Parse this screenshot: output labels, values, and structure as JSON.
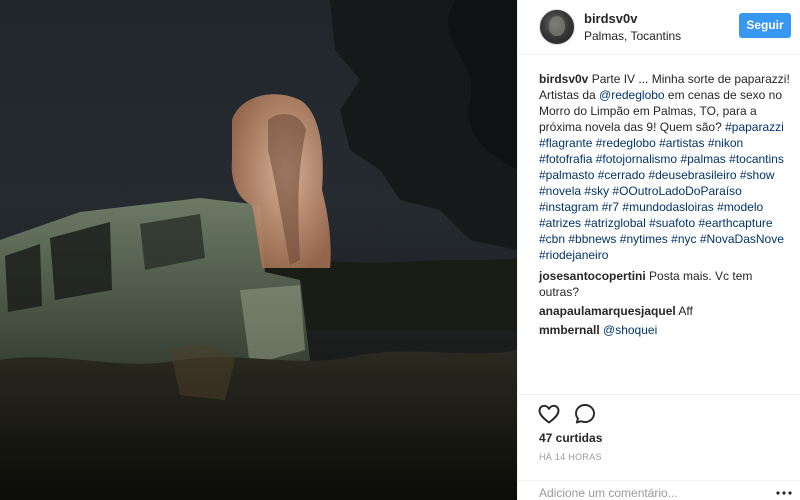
{
  "post": {
    "username": "birdsv0v",
    "location": "Palmas, Tocantins",
    "follow_label": "Seguir",
    "caption": {
      "user": "birdsv0v",
      "parts": [
        {
          "t": "text",
          "v": " Parte IV ... Minha sorte de paparazzi! Artistas da "
        },
        {
          "t": "mention",
          "v": "@redeglobo"
        },
        {
          "t": "text",
          "v": " em cenas de sexo no Morro do Limpão em Palmas, TO, para a próxima novela das 9! Quem são? "
        },
        {
          "t": "tag",
          "v": "#paparazzi"
        },
        {
          "t": "text",
          "v": " "
        },
        {
          "t": "tag",
          "v": "#flagrante"
        },
        {
          "t": "text",
          "v": " "
        },
        {
          "t": "tag",
          "v": "#redeglobo"
        },
        {
          "t": "text",
          "v": " "
        },
        {
          "t": "tag",
          "v": "#artistas"
        },
        {
          "t": "text",
          "v": " "
        },
        {
          "t": "tag",
          "v": "#nikon"
        },
        {
          "t": "text",
          "v": " "
        },
        {
          "t": "tag",
          "v": "#fotofrafia"
        },
        {
          "t": "text",
          "v": " "
        },
        {
          "t": "tag",
          "v": "#fotojornalismo"
        },
        {
          "t": "text",
          "v": " "
        },
        {
          "t": "tag",
          "v": "#palmas"
        },
        {
          "t": "text",
          "v": " "
        },
        {
          "t": "tag",
          "v": "#tocantins"
        },
        {
          "t": "text",
          "v": " "
        },
        {
          "t": "tag",
          "v": "#palmasto"
        },
        {
          "t": "text",
          "v": " "
        },
        {
          "t": "tag",
          "v": "#cerrado"
        },
        {
          "t": "text",
          "v": " "
        },
        {
          "t": "tag",
          "v": "#deusebrasileiro"
        },
        {
          "t": "text",
          "v": " "
        },
        {
          "t": "tag",
          "v": "#show"
        },
        {
          "t": "text",
          "v": " "
        },
        {
          "t": "tag",
          "v": "#novela"
        },
        {
          "t": "text",
          "v": " "
        },
        {
          "t": "tag",
          "v": "#sky"
        },
        {
          "t": "text",
          "v": " "
        },
        {
          "t": "tag",
          "v": "#OOutroLadoDoParaíso"
        },
        {
          "t": "text",
          "v": " "
        },
        {
          "t": "tag",
          "v": "#instagram"
        },
        {
          "t": "text",
          "v": " "
        },
        {
          "t": "tag",
          "v": "#r7"
        },
        {
          "t": "text",
          "v": " "
        },
        {
          "t": "tag",
          "v": "#mundodasloiras"
        },
        {
          "t": "text",
          "v": " "
        },
        {
          "t": "tag",
          "v": "#modelo"
        },
        {
          "t": "text",
          "v": " "
        },
        {
          "t": "tag",
          "v": "#atrizes"
        },
        {
          "t": "text",
          "v": " "
        },
        {
          "t": "tag",
          "v": "#atrizglobal"
        },
        {
          "t": "text",
          "v": " "
        },
        {
          "t": "tag",
          "v": "#suafoto"
        },
        {
          "t": "text",
          "v": " "
        },
        {
          "t": "tag",
          "v": "#earthcapture"
        },
        {
          "t": "text",
          "v": " "
        },
        {
          "t": "tag",
          "v": "#cbn"
        },
        {
          "t": "text",
          "v": " "
        },
        {
          "t": "tag",
          "v": "#bbnews"
        },
        {
          "t": "text",
          "v": " "
        },
        {
          "t": "tag",
          "v": "#nytimes"
        },
        {
          "t": "text",
          "v": " "
        },
        {
          "t": "tag",
          "v": "#nyc"
        },
        {
          "t": "text",
          "v": " "
        },
        {
          "t": "tag",
          "v": "#NovaDasNove"
        },
        {
          "t": "text",
          "v": " "
        },
        {
          "t": "tag",
          "v": "#riodejaneiro"
        }
      ]
    },
    "comments": [
      {
        "user": "josesantocopertini",
        "parts": [
          {
            "t": "text",
            "v": " Posta mais. Vc tem outras?"
          }
        ]
      },
      {
        "user": "anapaulamarquesjaquel",
        "parts": [
          {
            "t": "text",
            "v": " Aff"
          }
        ]
      },
      {
        "user": "mmbernall",
        "parts": [
          {
            "t": "text",
            "v": " "
          },
          {
            "t": "mention",
            "v": "@shoquei"
          }
        ]
      }
    ],
    "likes_text": "47 curtidas",
    "timestamp": "HÁ 14 HORAS",
    "comment_placeholder": "Adicione um comentário...",
    "icons": {
      "like": "heart-outline-icon",
      "comment": "speech-bubble-icon",
      "more": "ellipsis-icon"
    },
    "colors": {
      "follow_button": "#3897f0",
      "link": "#003569",
      "muted": "#999999"
    }
  }
}
